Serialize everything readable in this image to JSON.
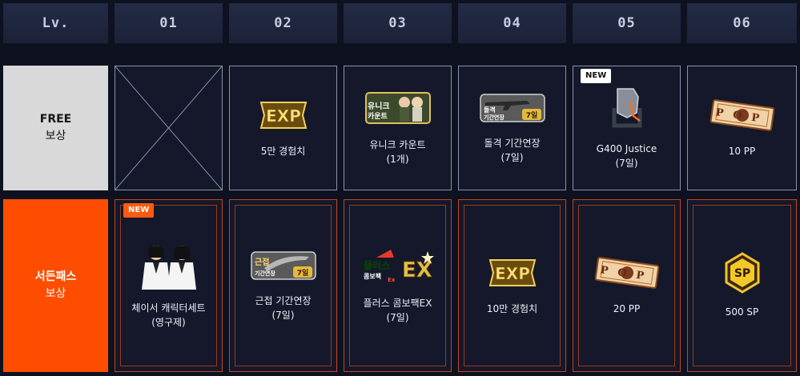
{
  "header": {
    "lv_label": "Lv.",
    "levels": [
      "01",
      "02",
      "03",
      "04",
      "05",
      "06"
    ]
  },
  "rows": {
    "free": {
      "title": "FREE",
      "subtitle": "보상"
    },
    "pass": {
      "title": "서든패스",
      "subtitle": "보상"
    }
  },
  "free_rewards": [
    {
      "label": "",
      "icon": "empty-slot-icon",
      "empty": true
    },
    {
      "label": "5만 경험치",
      "icon": "exp-icon"
    },
    {
      "label": "유니크 카운트\n(1개)",
      "icon": "unique-count-icon"
    },
    {
      "label": "돌격 기간연장\n(7일)",
      "icon": "assault-extension-icon"
    },
    {
      "label": "G400 Justice\n(7일)",
      "icon": "g400-justice-icon",
      "badge": "NEW"
    },
    {
      "label": "10 PP",
      "icon": "pp-ticket-icon"
    }
  ],
  "pass_rewards": [
    {
      "label": "체이서 캐릭터세트\n(영구제)",
      "icon": "chaser-character-icon",
      "badge": "NEW"
    },
    {
      "label": "근접 기간연장\n(7일)",
      "icon": "melee-extension-icon"
    },
    {
      "label": "플러스 콤보팩EX\n(7일)",
      "icon": "plus-combo-pack-icon"
    },
    {
      "label": "10만 경험치",
      "icon": "exp-icon"
    },
    {
      "label": "20 PP",
      "icon": "pp-ticket-icon"
    },
    {
      "label": "500 SP",
      "icon": "sp-icon"
    }
  ],
  "icon_text": {
    "exp": "EXP",
    "unique_line1": "유니크",
    "unique_line2": "카운트",
    "assault_line1": "돌격",
    "assault_line2": "기간연장",
    "days_7": "7일",
    "melee_line1": "근접",
    "melee_line2": "기간연장",
    "plus_line1": "플러스",
    "plus_line2": "콤보팩",
    "plus_ex": "EX",
    "plus_ex_small": "Ex",
    "pop": "POP",
    "sp": "SP"
  },
  "colors": {
    "free_label_bg": "#d9d9d9",
    "pass_label_bg": "#ff4d00",
    "gold": "#e0b23a",
    "page_bg": "#0e1220"
  }
}
